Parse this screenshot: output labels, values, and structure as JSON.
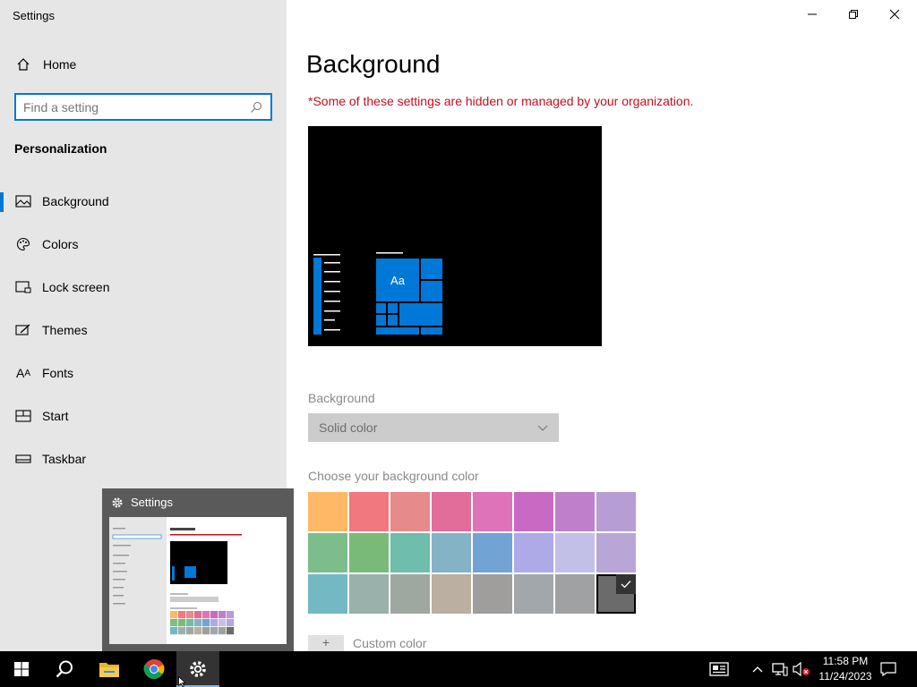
{
  "window": {
    "title": "Settings"
  },
  "nav": {
    "home_label": "Home",
    "search_placeholder": "Find a setting",
    "section_title": "Personalization",
    "items": [
      {
        "label": "Background",
        "icon": "image-icon",
        "active": true
      },
      {
        "label": "Colors",
        "icon": "palette-icon"
      },
      {
        "label": "Lock screen",
        "icon": "lock-screen-icon"
      },
      {
        "label": "Themes",
        "icon": "themes-icon"
      },
      {
        "label": "Fonts",
        "icon": "fonts-icon",
        "icon_text": "A"
      },
      {
        "label": "Start",
        "icon": "start-icon"
      },
      {
        "label": "Taskbar",
        "icon": "taskbar-icon"
      }
    ]
  },
  "main": {
    "title": "Background",
    "warning": "*Some of these settings are hidden or managed by your organization.",
    "preview": {
      "tile_label": "Aa",
      "accent": "#0078d7"
    },
    "background_label": "Background",
    "background_value": "Solid color",
    "color_label": "Choose your background color",
    "swatches": [
      "#ffb966",
      "#f0787e",
      "#e68a8c",
      "#e26c9a",
      "#df73b9",
      "#c86ac3",
      "#bf7fca",
      "#b69ed4",
      "#7dbd8c",
      "#7aba78",
      "#6fbdab",
      "#85b3c6",
      "#71a3d4",
      "#aeaae8",
      "#c3c0e8",
      "#b8a6d6",
      "#73b8c2",
      "#9ab0ab",
      "#9fa7a1",
      "#baafa0",
      "#a09e9c",
      "#a1a7ab",
      "#9fa1a3",
      "#6b6b6b"
    ],
    "selected_swatch": 23,
    "custom_color_label": "Custom color"
  },
  "thumbnail": {
    "title": "Settings"
  },
  "taskbar": {
    "time": "11:58 PM",
    "date": "11/24/2023"
  }
}
